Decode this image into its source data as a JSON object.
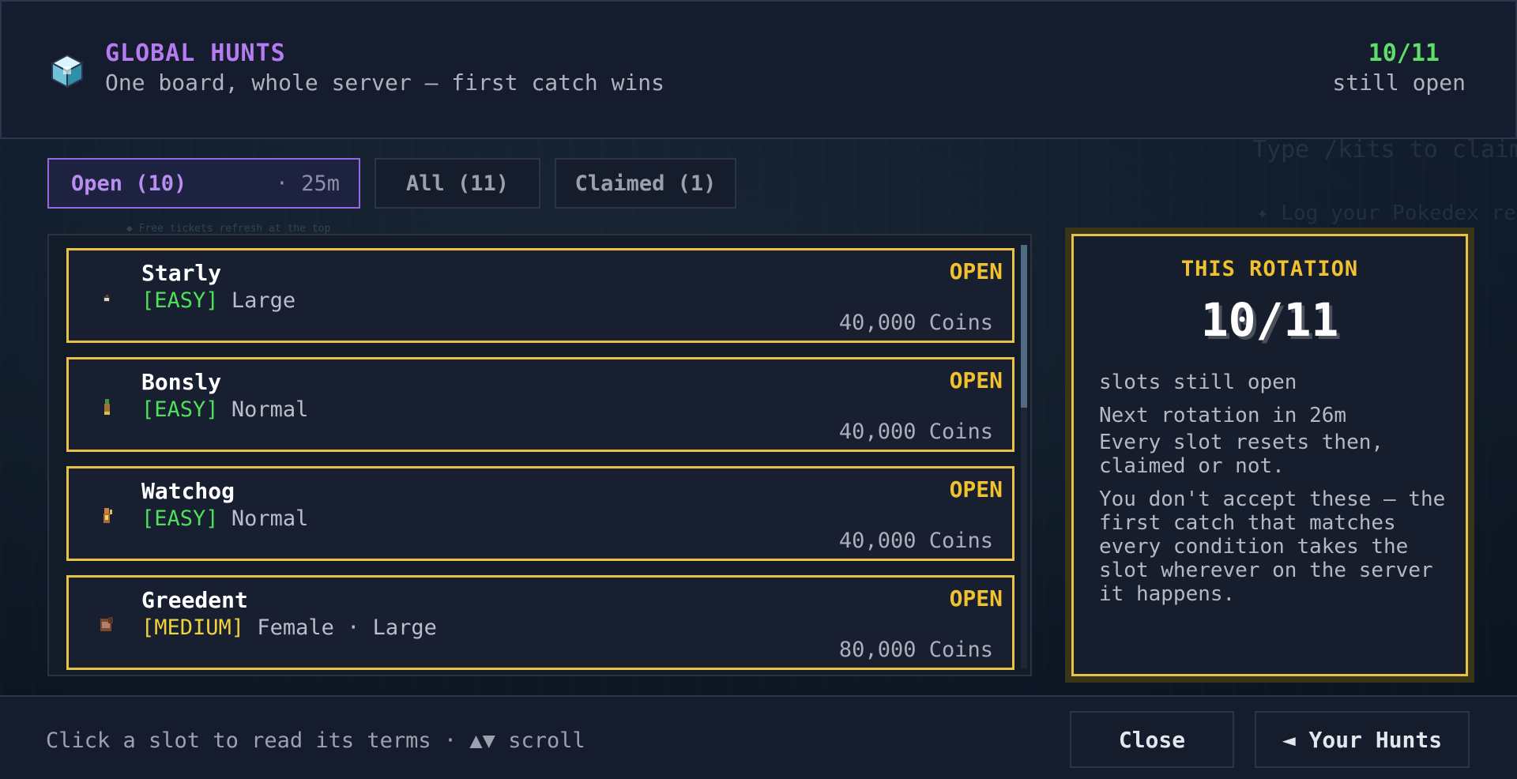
{
  "header": {
    "title": "GLOBAL HUNTS",
    "subtitle": "One board, whole server — first catch wins",
    "open_count": "10/11",
    "open_label": "still open"
  },
  "tabs": [
    {
      "label": "Open (10)",
      "timer": "· 25m",
      "active": true
    },
    {
      "label": "All (11)",
      "active": false
    },
    {
      "label": "Claimed (1)",
      "active": false
    }
  ],
  "slots": [
    {
      "name": "Starly",
      "difficulty": "[EASY]",
      "traits": "Large",
      "status": "OPEN",
      "reward": "40,000 Coins"
    },
    {
      "name": "Bonsly",
      "difficulty": "[EASY]",
      "traits": "Normal",
      "status": "OPEN",
      "reward": "40,000 Coins"
    },
    {
      "name": "Watchog",
      "difficulty": "[EASY]",
      "traits": "Normal",
      "status": "OPEN",
      "reward": "40,000 Coins"
    },
    {
      "name": "Greedent",
      "difficulty": "[MEDIUM]",
      "traits": "Female · Large",
      "status": "OPEN",
      "reward": "80,000 Coins"
    }
  ],
  "rotation": {
    "title": "THIS ROTATION",
    "count": "10/11",
    "slots_label": "slots still open",
    "next": "Next rotation in 26m",
    "reset_note": "Every slot resets then, claimed or not.",
    "accept_note": "You don't accept these — the first catch that matches every condition takes the slot wherever on the server it happens."
  },
  "footer": {
    "hint": "Click a slot to read its terms  ·  ▲▼ scroll",
    "close_label": "Close",
    "hunts_label": "◄ Your Hunts"
  },
  "colors": {
    "accent_purple": "#b57bf0",
    "open_green": "#5fdd6a",
    "gold": "#e8c243",
    "easy": "#4fe05a",
    "medium": "#f0d23c"
  },
  "icons": [
    "cube-icon",
    "starly-sprite-icon",
    "bonsly-sprite-icon",
    "watchog-sprite-icon",
    "greedent-sprite-icon",
    "arrow-left-icon"
  ],
  "background": {
    "line1": "Type /kits to claim",
    "line2": "✦ Log your Pokedex rese",
    "tiny": "◆ Free tickets refresh at the top of every hour, don't miss them"
  }
}
